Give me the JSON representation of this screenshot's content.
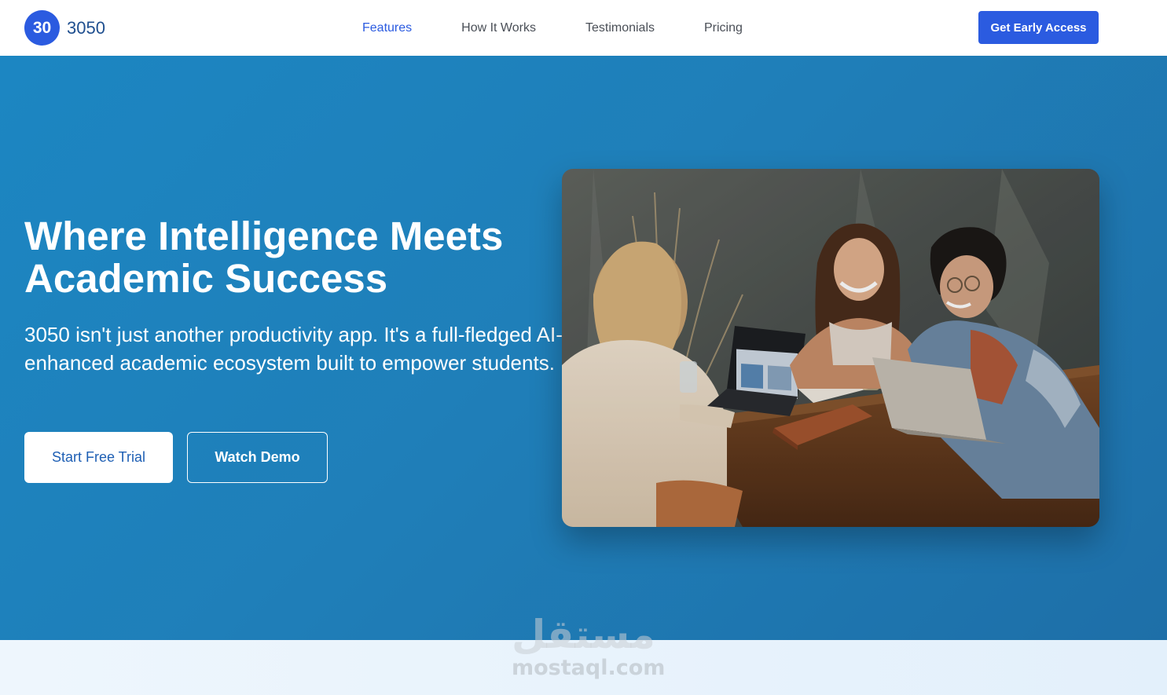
{
  "brand": {
    "badge": "30",
    "name": "3050"
  },
  "nav": {
    "links": [
      "Features",
      "How It Works",
      "Testimonials",
      "Pricing"
    ],
    "active": "Features",
    "cta": "Get Early Access"
  },
  "hero": {
    "title_line1": "Where Intelligence Meets",
    "title_line2": "Academic Success",
    "subtitle": "3050 isn't just another productivity app. It's a full-fledged AI-enhanced academic ecosystem built to empower students.",
    "primary_button": "Start Free Trial",
    "secondary_button": "Watch Demo",
    "image": "students-collaborating-photo"
  },
  "watermark": {
    "arabic": "مستقل",
    "latin": "mostaql.com"
  },
  "colors": {
    "accent": "#2b5be0",
    "hero_bg": "#1d7fbb",
    "nav_text": "#4a4f57",
    "brand_text": "#1f4f8f"
  },
  "icons": [
    "logo-badge-icon"
  ]
}
